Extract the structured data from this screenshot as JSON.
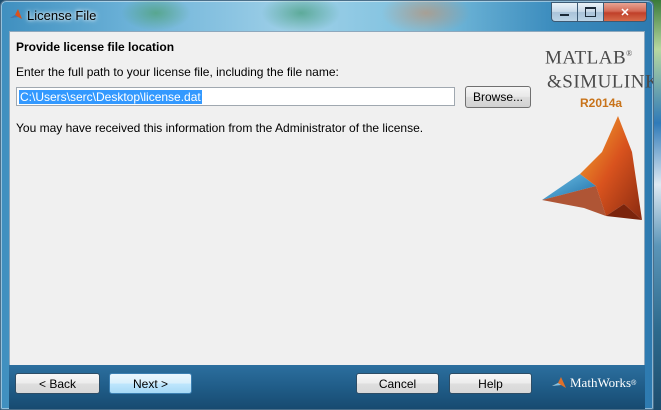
{
  "window": {
    "title": "License File",
    "controls": {
      "minimize_icon": "minimize-icon",
      "maximize_icon": "maximize-icon",
      "close_icon": "close-icon",
      "close_glyph": "✕"
    }
  },
  "main": {
    "heading": "Provide license file location",
    "instruction": "Enter the full path to your license file, including the file name:",
    "path_input": {
      "value": "C:\\Users\\serc\\Desktop\\license.dat",
      "selected": true
    },
    "browse_label": "Browse...",
    "note": "You may have received this information from the Administrator of the license."
  },
  "branding": {
    "product_line1": "MATLAB",
    "product_line1_mark": "®",
    "product_line2": "&SIMULINK",
    "product_line2_mark": "®",
    "release": "R2014a",
    "logo_icon": "matlab-membrane-icon"
  },
  "footer": {
    "back_label": "< Back",
    "next_label": "Next >",
    "cancel_label": "Cancel",
    "help_label": "Help",
    "company": "MathWorks",
    "company_mark": "®"
  },
  "colors": {
    "selection": "#3399ff",
    "footer_bar": "#1f5b86",
    "release_orange": "#c8731a"
  }
}
